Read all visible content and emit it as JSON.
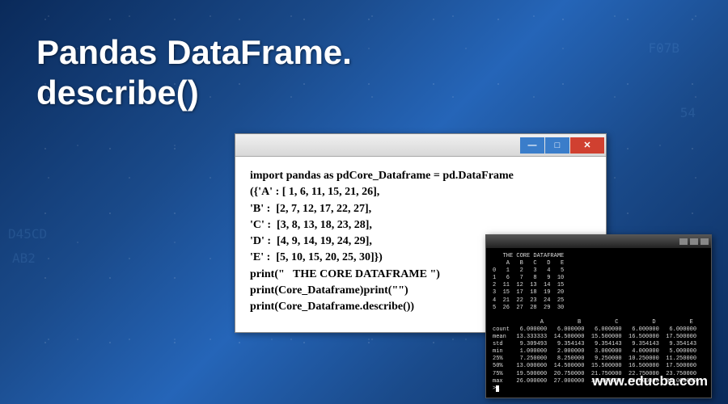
{
  "title_line1": "Pandas DataFrame.",
  "title_line2": "describe()",
  "code_window": {
    "content": "import pandas as pdCore_Dataframe = pd.DataFrame\n({'A' : [ 1, 6, 11, 15, 21, 26],\n'B' :  [2, 7, 12, 17, 22, 27],\n'C' :  [3, 8, 13, 18, 23, 28],\n'D' :  [4, 9, 14, 19, 24, 29],\n'E' :  [5, 10, 15, 20, 25, 30]})\nprint(\"   THE CORE DATAFRAME \")\nprint(Core_Dataframe)print(\"\")\nprint(Core_Dataframe.describe())"
  },
  "terminal": {
    "output": "   THE CORE DATAFRAME\n    A   B   C   D   E\n0   1   2   3   4   5\n1   6   7   8   9  10\n2  11  12  13  14  15\n3  15  17  18  19  20\n4  21  22  23  24  25\n5  26  27  28  29  30\n\n              A          B          C          D          E\ncount   6.000000   6.000000   6.000000   6.000000   6.000000\nmean   13.333333  14.500000  15.500000  16.500000  17.500000\nstd     9.309493   9.354143   9.354143   9.354143   9.354143\nmin     1.000000   2.000000   3.000000   4.000000   5.000000\n25%     7.250000   8.250000   9.250000  10.250000  11.250000\n50%    13.000000  14.500000  15.500000  16.500000  17.500000\n75%    19.500000  20.750000  21.750000  22.750000  23.750000\nmax    26.000000  27.000000  28.000000  29.000000  30.000000"
  },
  "watermark": "www.educba.com",
  "bg_fragments": [
    "D45CD",
    "AB2",
    "F07B",
    "54",
    "2",
    "8"
  ]
}
